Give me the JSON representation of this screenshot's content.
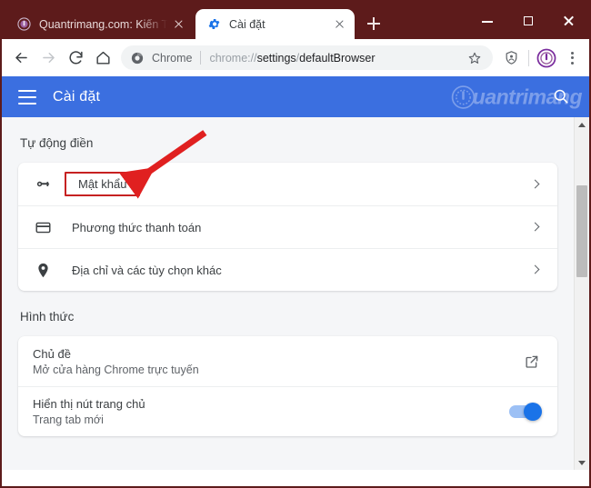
{
  "browser": {
    "tabs": [
      {
        "title": "Quantrimang.com: Kiến Thức",
        "favicon": "quantrimang-logo-icon",
        "active": false
      },
      {
        "title": "Cài đặt",
        "favicon": "gear-icon",
        "active": true
      }
    ],
    "new_tab_label": "+",
    "window_controls": {
      "minimize": "–",
      "maximize": "□",
      "close": "✕"
    },
    "toolbar": {
      "back": "back-arrow",
      "forward": "forward-arrow",
      "reload": "reload-arrow",
      "home": "home-icon",
      "omnibox": {
        "scheme_label": "Chrome",
        "url_prefix": "chrome://",
        "url_bold_1": "settings",
        "url_mid": "/",
        "url_bold_2": "defaultBrowser",
        "full_url": "chrome://settings/defaultBrowser"
      },
      "bookmark": "star-icon",
      "shield": "shield-person-icon",
      "profile": "profile-avatar",
      "menu": "three-dot-menu"
    },
    "colors": {
      "titlebar": "#5D1B1B",
      "settings_header": "#3B6FE0",
      "accent_blue": "#1A73E8",
      "annotation_red": "#C62121",
      "content_bg": "#F5F6F8"
    }
  },
  "settings_header": {
    "menu_icon": "hamburger-icon",
    "title": "Cài đặt",
    "search_icon": "search-icon",
    "watermark_text": "uantrimang"
  },
  "sections": [
    {
      "label": "Tự động điền",
      "rows": [
        {
          "icon": "key-icon",
          "label": "Mật khẩu",
          "control": "chevron",
          "highlighted": true
        },
        {
          "icon": "credit-card-icon",
          "label": "Phương thức thanh toán",
          "control": "chevron",
          "highlighted": false
        },
        {
          "icon": "location-pin-icon",
          "label": "Địa chỉ và các tùy chọn khác",
          "control": "chevron",
          "highlighted": false
        }
      ]
    },
    {
      "label": "Hình thức",
      "rows": [
        {
          "primary": "Chủ đề",
          "secondary": "Mở cửa hàng Chrome trực tuyến",
          "control": "external-link"
        },
        {
          "primary": "Hiển thị nút trang chủ",
          "secondary": "Trang tab mới",
          "control": "toggle",
          "toggle_on": true
        }
      ]
    }
  ],
  "annotation": {
    "type": "arrow",
    "color": "#E02020",
    "points_to": "Mật khẩu"
  },
  "scrollbar": {
    "up_arrow": "▲",
    "down_arrow": "▼",
    "thumb_position": "upper-middle"
  }
}
